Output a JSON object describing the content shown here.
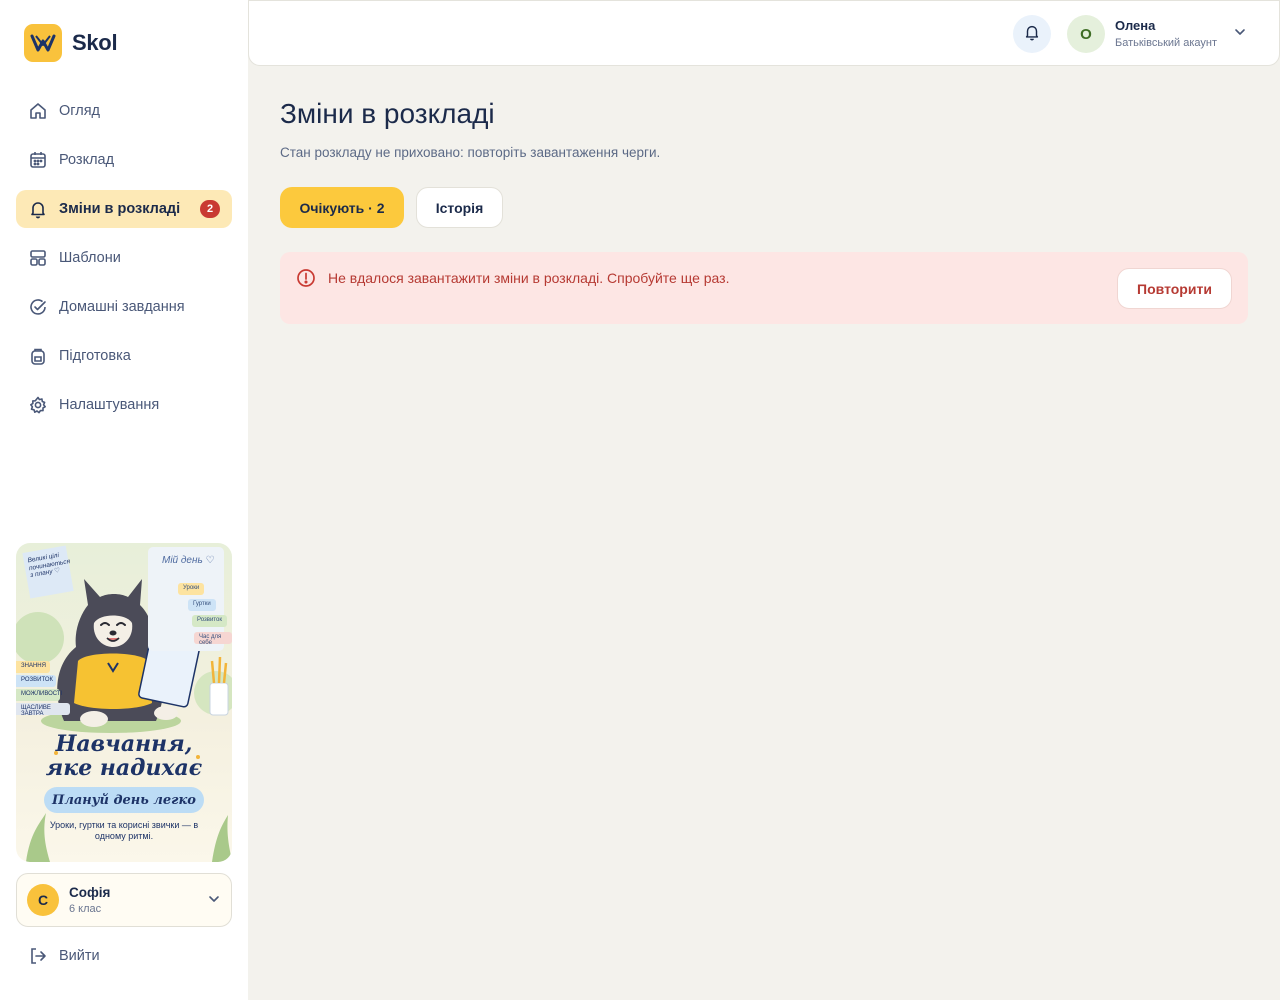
{
  "brand": {
    "name": "Skol",
    "accent": "#f9c23c"
  },
  "sidebar": {
    "items": [
      {
        "label": "Огляд",
        "icon": "home-icon"
      },
      {
        "label": "Розклад",
        "icon": "calendar-icon"
      },
      {
        "label": "Зміни в розкладі",
        "icon": "bell-icon",
        "active": true,
        "badge": "2"
      },
      {
        "label": "Шаблони",
        "icon": "template-icon"
      },
      {
        "label": "Домашні завдання",
        "icon": "check-circle-icon"
      },
      {
        "label": "Підготовка",
        "icon": "backpack-icon"
      },
      {
        "label": "Налаштування",
        "icon": "gear-icon"
      }
    ]
  },
  "promo": {
    "headline_line1": "Навчання,",
    "headline_line2": "яке надихає",
    "pill": "Плануй день легко",
    "caption": "Уроки, гуртки та корисні звички — в одному ритмі.",
    "note": "Великі цілі починаються з плану ♡",
    "board_title": "Мій день ♡",
    "chips": [
      "Уроки",
      "Гуртки",
      "Розвиток",
      "Час для себе"
    ],
    "tags": [
      "ЗНАННЯ",
      "РОЗВИТОК",
      "МОЖЛИВОСТІ",
      "ЩАСЛИВЕ ЗАВТРА"
    ]
  },
  "student": {
    "initial": "С",
    "name": "Софія",
    "grade": "6 клас"
  },
  "logout": {
    "label": "Вийти"
  },
  "header": {
    "user": {
      "initial": "О",
      "name": "Олена",
      "role": "Батьківський акаунт"
    }
  },
  "main": {
    "title": "Зміни в розкладі",
    "subtitle": "Стан розкладу не приховано: повторіть завантаження черги.",
    "tabs": [
      {
        "label": "Очікують · 2",
        "active": true
      },
      {
        "label": "Історія",
        "active": false
      }
    ],
    "alert": {
      "message": "Не вдалося завантажити зміни в розкладі. Спробуйте ще раз.",
      "retry_label": "Повторити",
      "color": "#b63a33"
    }
  }
}
